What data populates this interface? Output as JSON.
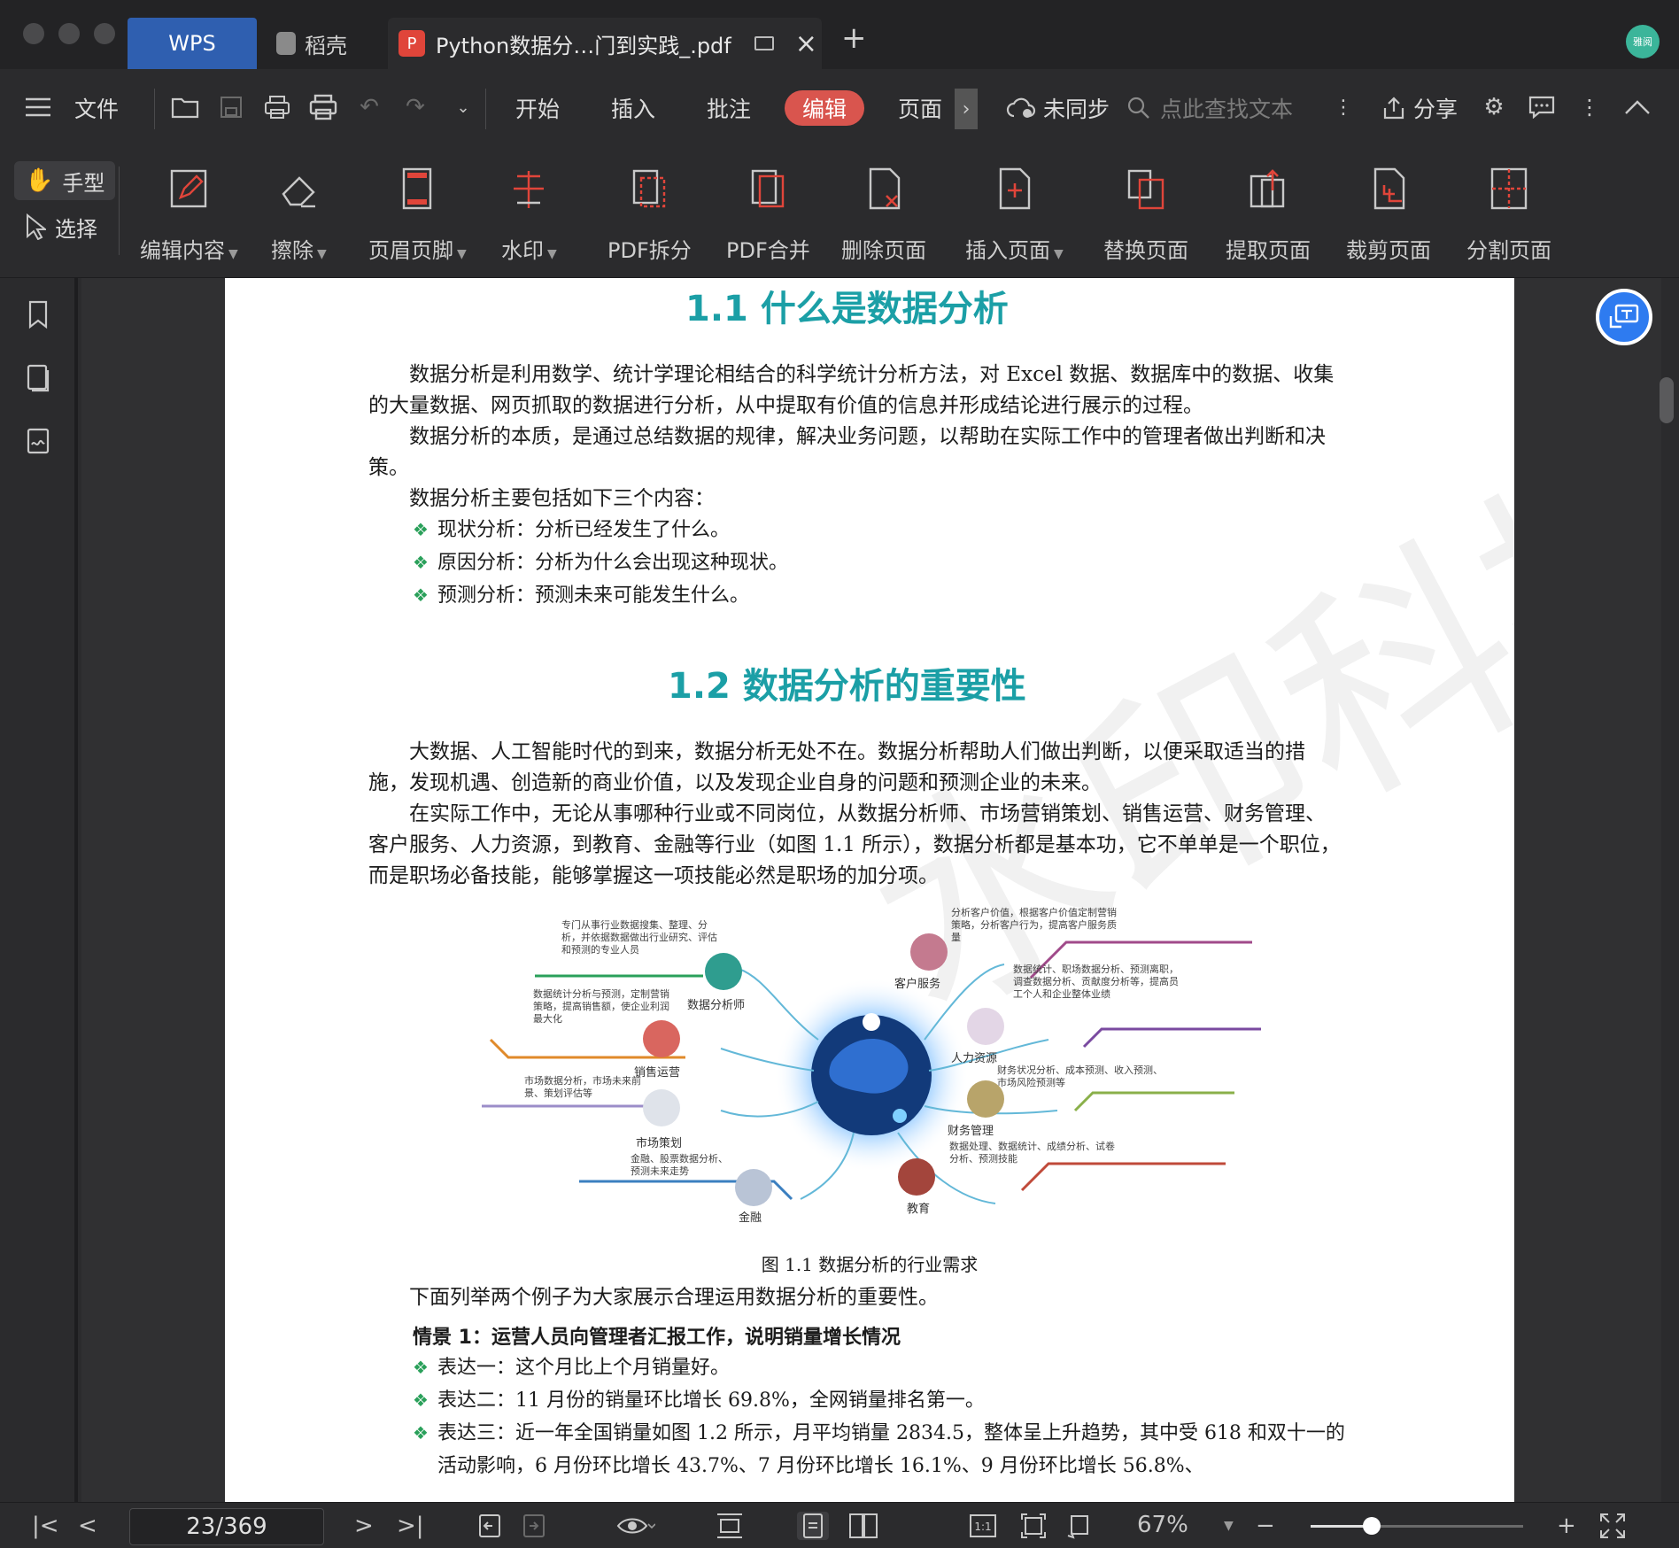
{
  "tabs": {
    "wps": "WPS",
    "daoke": "稻壳",
    "document": "Python数据分…门到实践_.pdf"
  },
  "user": {
    "avatar_text": "雅阅"
  },
  "menubar": {
    "menu": "文件",
    "tabs": [
      "开始",
      "插入",
      "批注",
      "编辑",
      "页面"
    ],
    "active_tab": "编辑",
    "sync_status": "未同步",
    "search_placeholder": "点此查找文本",
    "share": "分享"
  },
  "ribbon": {
    "hand_mode": "手型",
    "select_mode": "选择",
    "tools": [
      {
        "label": "编辑内容",
        "icon": "edit-content-icon",
        "dropdown": true
      },
      {
        "label": "擦除",
        "icon": "eraser-icon",
        "dropdown": true
      },
      {
        "label": "页眉页脚",
        "icon": "header-footer-icon",
        "dropdown": true
      },
      {
        "label": "水印",
        "icon": "watermark-icon",
        "dropdown": true
      },
      {
        "label": "PDF拆分",
        "icon": "pdf-split-icon",
        "dropdown": false
      },
      {
        "label": "PDF合并",
        "icon": "pdf-merge-icon",
        "dropdown": false
      },
      {
        "label": "删除页面",
        "icon": "delete-page-icon",
        "dropdown": false
      },
      {
        "label": "插入页面",
        "icon": "insert-page-icon",
        "dropdown": true
      },
      {
        "label": "替换页面",
        "icon": "replace-page-icon",
        "dropdown": false
      },
      {
        "label": "提取页面",
        "icon": "extract-page-icon",
        "dropdown": false
      },
      {
        "label": "裁剪页面",
        "icon": "crop-page-icon",
        "dropdown": false
      },
      {
        "label": "分割页面",
        "icon": "split-page-icon",
        "dropdown": false
      }
    ]
  },
  "document": {
    "section1_title": "1.1  什么是数据分析",
    "section1_paras": [
      "数据分析是利用数学、统计学理论相结合的科学统计分析方法，对 Excel 数据、数据库中的数据、收集的大量数据、网页抓取的数据进行分析，从中提取有价值的信息并形成结论进行展示的过程。",
      "数据分析的本质，是通过总结数据的规律，解决业务问题，以帮助在实际工作中的管理者做出判断和决策。",
      "数据分析主要包括如下三个内容："
    ],
    "section1_bullets": [
      "现状分析：分析已经发生了什么。",
      "原因分析：分析为什么会出现这种现状。",
      "预测分析：预测未来可能发生什么。"
    ],
    "section2_title": "1.2  数据分析的重要性",
    "section2_paras": [
      "大数据、人工智能时代的到来，数据分析无处不在。数据分析帮助人们做出判断，以便采取适当的措施，发现机遇、创造新的商业价值，以及发现企业自身的问题和预测企业的未来。",
      "在实际工作中，无论从事哪种行业或不同岗位，从数据分析师、市场营销策划、销售运营、财务管理、客户服务、人力资源，到教育、金融等行业（如图 1.1 所示），数据分析都是基本功，它不单单是一个职位，而是职场必备技能，能够掌握这一项技能必然是职场的加分项。"
    ],
    "figure": {
      "nodes": [
        {
          "label": "数据分析师",
          "desc": "专门从事行业数据搜集、整理、分析，并依据数据做出行业研究、评估和预测的专业人员"
        },
        {
          "label": "销售运营",
          "desc": "数据统计分析与预测，定制营销策略，提高销售额，使企业利润最大化"
        },
        {
          "label": "市场策划",
          "desc": "市场数据分析，市场未来前景、策划评估等"
        },
        {
          "label": "金融",
          "desc": "金融、股票数据分析、预测未来走势"
        },
        {
          "label": "客户服务",
          "desc": "分析客户价值，根据客户价值定制营销策略，分析客户行为，提高客户服务质量"
        },
        {
          "label": "人力资源",
          "desc": "数据统计、职场数据分析、预测离职，调查数据分析、贡献度分析等，提高员工个人和企业整体业绩"
        },
        {
          "label": "财务管理",
          "desc": "财务状况分析、成本预测、收入预测、市场风险预测等"
        },
        {
          "label": "教育",
          "desc": "数据处理、数据统计、成绩分析、试卷分析、预测技能"
        }
      ],
      "caption": "图 1.1   数据分析的行业需求"
    },
    "intro_examples": "下面列举两个例子为大家展示合理运用数据分析的重要性。",
    "scenario_title": "情景 1：运营人员向管理者汇报工作，说明销量增长情况",
    "scenario_bullets": [
      "表达一：这个月比上个月销量好。",
      "表达二：11 月份的销量环比增长 69.8%，全网销量排名第一。",
      "表达三：近一年全国销量如图 1.2 所示，月平均销量 2834.5，整体呈上升趋势，其中受 618 和双十一的活动影响，6 月份环比增长 43.7%、7 月份环比增长 16.1%、9 月份环比增长 56.8%、"
    ]
  },
  "statusbar": {
    "page_indicator": "23/369",
    "zoom": "67%",
    "zoom_level": 0.67
  },
  "colors": {
    "accent_edit": "#d9554e",
    "heading": "#1b9fa6",
    "wps_tab": "#2f5fb0"
  }
}
